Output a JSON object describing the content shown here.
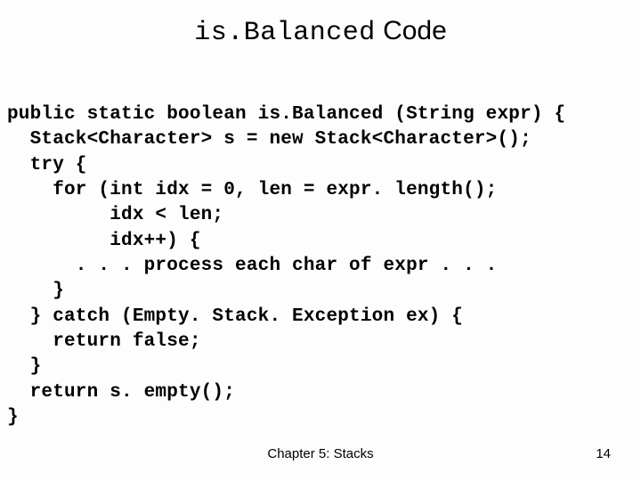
{
  "title": {
    "mono": "is.Balanced",
    "rest": " Code"
  },
  "code": "public static boolean is.Balanced (String expr) {\n  Stack<Character> s = new Stack<Character>();\n  try {\n    for (int idx = 0, len = expr. length();\n         idx < len;\n         idx++) {\n      . . . process each char of expr . . .\n    }\n  } catch (Empty. Stack. Exception ex) {\n    return false;\n  }\n  return s. empty();\n}",
  "footer": {
    "center": "Chapter 5: Stacks",
    "page": "14"
  }
}
